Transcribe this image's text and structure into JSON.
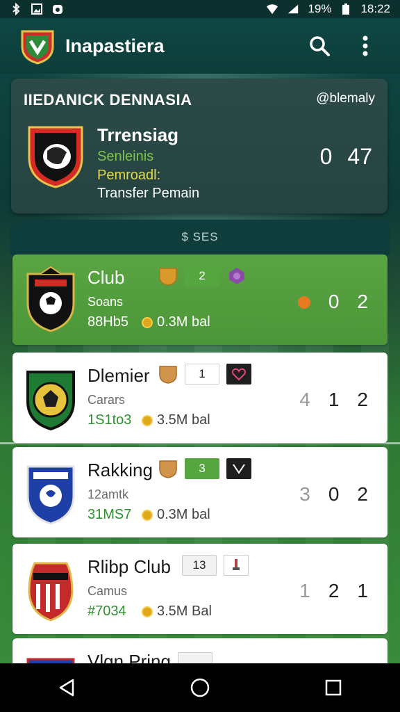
{
  "status_bar": {
    "battery": "19%",
    "time": "18:22"
  },
  "app_bar": {
    "title": "Inapastiera",
    "icons": [
      "search-icon",
      "more-vert-icon"
    ]
  },
  "featured": {
    "title": "IIEDANICK DENNASIA",
    "link": "@blemaly",
    "name": "Trrensiag",
    "line1": "Senleinis",
    "line2": "Pemroadl:",
    "line3": "Transfer Pemain",
    "score": [
      "0",
      "47"
    ]
  },
  "section": {
    "label": "$ SES"
  },
  "rows": [
    {
      "name": "Club",
      "sub": "Soans",
      "stat": "88Hb5",
      "value": "0.3M bal",
      "pill": "2",
      "scores": [
        "0",
        "2"
      ]
    },
    {
      "name": "Dlemier",
      "sub": "Carars",
      "stat": "1S1to3",
      "value": "3.5M bal",
      "pill": "1",
      "scores": [
        "4",
        "1",
        "2"
      ]
    },
    {
      "name": "Rakking",
      "sub": "12amtk",
      "stat": "31MS7",
      "value": "0.3M bal",
      "pill": "3",
      "scores": [
        "3",
        "0",
        "2"
      ]
    },
    {
      "name": "Rlibp Club",
      "sub": "Camus",
      "stat": "#7034",
      "value": "3.5M Bal",
      "pill": "13",
      "scores": [
        "1",
        "2",
        "1"
      ]
    },
    {
      "name": "Vlgn Pring",
      "sub": "",
      "stat": "",
      "value": "",
      "pill": "",
      "scores": []
    }
  ],
  "colors": {
    "header_bg": "#0f4744",
    "highlight_row": "#4f9a3b",
    "accent_green": "#56a63f"
  }
}
